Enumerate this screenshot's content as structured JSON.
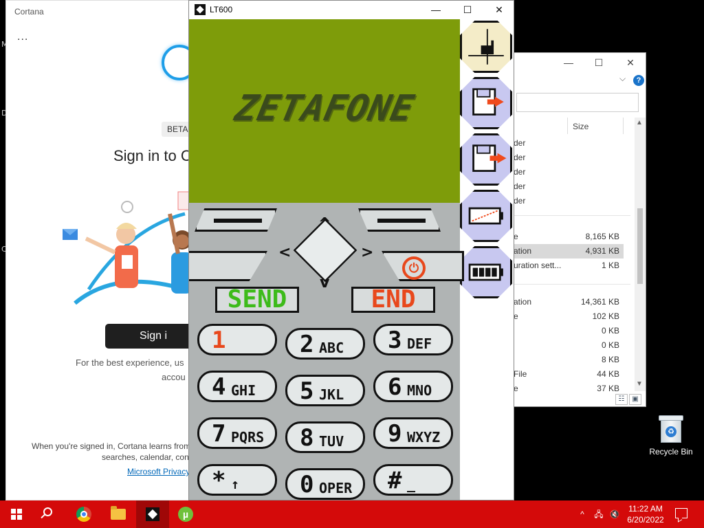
{
  "desktop": {
    "left_fragments": [
      "M",
      "D",
      "C"
    ],
    "recycle_bin_label": "Recycle Bin"
  },
  "cortana": {
    "window_title": "Cortana",
    "menu_glyph": "...",
    "beta_badge": "BETA",
    "heading": "Sign in to C",
    "signin_button": "Sign i",
    "hint_line1": "For the best experience, us",
    "hint_line2": "accou",
    "fine_line1": "When you're signed in, Cortana learns from",
    "fine_line2": "searches, calendar, cont",
    "privacy_link": "Microsoft Privacy"
  },
  "explorer": {
    "minimize": "—",
    "maximize": "☐",
    "close": "✕",
    "help": "?",
    "column_size": "Size",
    "folder_rows": [
      "der",
      "der",
      "der",
      "der",
      "der"
    ],
    "rows": [
      {
        "name": "e",
        "size": "8,165 KB"
      },
      {
        "name": "ation",
        "size": "4,931 KB"
      },
      {
        "name": "uration sett...",
        "size": "1 KB"
      },
      {
        "name": "ation",
        "size": "14,361 KB"
      },
      {
        "name": "e",
        "size": "102 KB"
      },
      {
        "name": "",
        "size": "0 KB"
      },
      {
        "name": "",
        "size": "0 KB"
      },
      {
        "name": "",
        "size": "8 KB"
      },
      {
        "name": "File",
        "size": "44 KB"
      },
      {
        "name": "e",
        "size": "37 KB"
      }
    ]
  },
  "lt600": {
    "window_title": "LT600",
    "minimize": "—",
    "maximize": "☐",
    "close": "✕",
    "brand": "ZETAFONE",
    "send_label": "SEND",
    "end_label": "END",
    "power_glyph": "⏻",
    "dpad": {
      "up": "^",
      "down": "v",
      "left": "<",
      "right": ">"
    },
    "keys": [
      {
        "digit": "1",
        "letters": ""
      },
      {
        "digit": "2",
        "letters": "ABC"
      },
      {
        "digit": "3",
        "letters": "DEF"
      },
      {
        "digit": "4",
        "letters": "GHI"
      },
      {
        "digit": "5",
        "letters": "JKL"
      },
      {
        "digit": "6",
        "letters": "MNO"
      },
      {
        "digit": "7",
        "letters": "PQRS"
      },
      {
        "digit": "8",
        "letters": "TUV"
      },
      {
        "digit": "9",
        "letters": "WXYZ"
      },
      {
        "digit": "*",
        "letters": "↑"
      },
      {
        "digit": "0",
        "letters": "OPER"
      },
      {
        "digit": "#",
        "letters": "_"
      }
    ],
    "sidebar_icons": [
      "plug-icon",
      "save-state-icon",
      "load-state-icon",
      "battery-off-icon",
      "battery-full-icon"
    ],
    "colors": {
      "screen": "#7e9c0a",
      "send": "#3dbb1a",
      "end": "#e8481c"
    }
  },
  "taskbar": {
    "apps": [
      "start",
      "search",
      "chrome",
      "file-explorer",
      "lt600",
      "utorrent"
    ],
    "tray_up_arrow": "^",
    "time": "11:22 AM",
    "date": "6/20/2022",
    "color": "#d40a0a"
  }
}
